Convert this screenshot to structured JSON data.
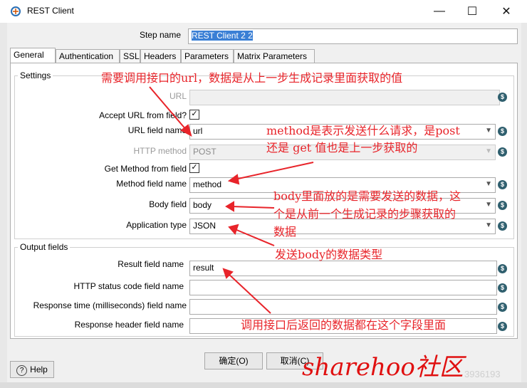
{
  "window": {
    "title": "REST Client"
  },
  "step": {
    "label": "Step name",
    "value": "REST Client 2 2"
  },
  "tabs": [
    {
      "label": "General"
    },
    {
      "label": "Authentication"
    },
    {
      "label": "SSL"
    },
    {
      "label": "Headers"
    },
    {
      "label": "Parameters"
    },
    {
      "label": "Matrix Parameters"
    }
  ],
  "settings": {
    "title": "Settings",
    "url_label": "URL",
    "accept_url_label": "Accept URL from field?",
    "url_field_label": "URL field name",
    "url_field_value": "url",
    "http_method_label": "HTTP method",
    "http_method_value": "POST",
    "get_method_label": "Get Method from field",
    "method_field_label": "Method field name",
    "method_field_value": "method",
    "body_field_label": "Body field",
    "body_field_value": "body",
    "app_type_label": "Application type",
    "app_type_value": "JSON"
  },
  "output": {
    "title": "Output fields",
    "result_label": "Result field name",
    "result_value": "result",
    "status_label": "HTTP status code field name",
    "response_time_label": "Response time (milliseconds) field name",
    "response_header_label": "Response header field name"
  },
  "buttons": {
    "help": "Help",
    "ok": "确定(O)",
    "cancel": "取消(C)"
  },
  "annotations": {
    "a1": "需要调用接口的url，数据是从上一步生成记录里面获取的值",
    "a2_line1": "method是表示发送什么请求，是post",
    "a2_line2": "还是 get 值也是上一步获取的",
    "a3_line1": "body里面放的是需要发送的数据，这",
    "a3_line2": "个是从前一个生成记录的步骤获取的",
    "a3_line3": "数据",
    "a4": "发送body的数据类型",
    "a5": "调用接口后返回的数据都在这个字段里面"
  },
  "watermark": {
    "brand": "sharehoo社区",
    "small": "3936193"
  },
  "icons": {
    "variable": "variable-dollar-icon",
    "app": "rest-client-icon"
  },
  "colors": {
    "annotation": "#e8242a",
    "selection": "#3a7fd5"
  }
}
